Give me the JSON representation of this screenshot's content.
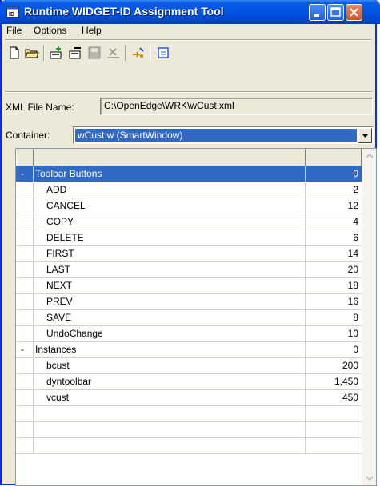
{
  "window": {
    "title": "Runtime WIDGET-ID Assignment Tool"
  },
  "menu": [
    "File",
    "Options",
    "Help"
  ],
  "toolbar_icons": [
    "new-file-icon",
    "open-folder-icon",
    "add-widget-icon",
    "remove-widget-icon",
    "save-icon",
    "delete-icon",
    "assign-icon",
    "window-icon"
  ],
  "xml": {
    "label": "XML File Name:",
    "value": "C:\\OpenEdge\\WRK\\wCust.xml"
  },
  "container": {
    "label": "Container:",
    "value": "wCust.w (SmartWindow)"
  },
  "rows": [
    {
      "marker": "-",
      "name": "Toolbar Buttons",
      "value": "0",
      "level": 0,
      "selected": true
    },
    {
      "marker": "",
      "name": "ADD",
      "value": "2",
      "level": 1
    },
    {
      "marker": "",
      "name": "CANCEL",
      "value": "12",
      "level": 1
    },
    {
      "marker": "",
      "name": "COPY",
      "value": "4",
      "level": 1
    },
    {
      "marker": "",
      "name": "DELETE",
      "value": "6",
      "level": 1
    },
    {
      "marker": "",
      "name": "FIRST",
      "value": "14",
      "level": 1
    },
    {
      "marker": "",
      "name": "LAST",
      "value": "20",
      "level": 1
    },
    {
      "marker": "",
      "name": "NEXT",
      "value": "18",
      "level": 1
    },
    {
      "marker": "",
      "name": "PREV",
      "value": "16",
      "level": 1
    },
    {
      "marker": "",
      "name": "SAVE",
      "value": "8",
      "level": 1
    },
    {
      "marker": "",
      "name": "UndoChange",
      "value": "10",
      "level": 1
    },
    {
      "marker": "-",
      "name": "Instances",
      "value": "0",
      "level": 0
    },
    {
      "marker": "",
      "name": "bcust",
      "value": "200",
      "level": 1
    },
    {
      "marker": "",
      "name": "dyntoolbar",
      "value": "1,450",
      "level": 1
    },
    {
      "marker": "",
      "name": "vcust",
      "value": "450",
      "level": 1
    },
    {
      "marker": "",
      "name": "",
      "value": "",
      "level": 1
    },
    {
      "marker": "",
      "name": "",
      "value": "",
      "level": 1
    },
    {
      "marker": "",
      "name": "",
      "value": "",
      "level": 1
    }
  ],
  "colors": {
    "titlebar": "#0054e3",
    "selection": "#316ac5",
    "face": "#ece9d8"
  }
}
